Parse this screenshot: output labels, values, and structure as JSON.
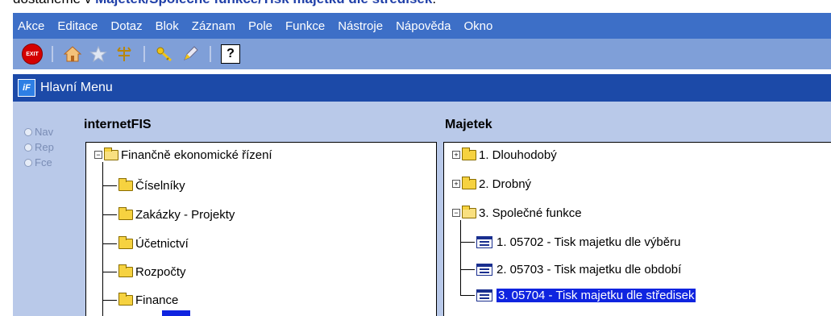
{
  "caption": {
    "prefix": "dostaneme v ",
    "path": "Majetek/Společné funkce/Tisk majetku dle středisek",
    "suffix": "."
  },
  "menubar": {
    "items": [
      {
        "label": "Akce"
      },
      {
        "label": "Editace"
      },
      {
        "label": "Dotaz"
      },
      {
        "label": "Blok"
      },
      {
        "label": "Záznam"
      },
      {
        "label": "Pole"
      },
      {
        "label": "Funkce"
      },
      {
        "label": "Nástroje"
      },
      {
        "label": "Nápověda"
      },
      {
        "label": "Okno"
      }
    ]
  },
  "toolbar": {
    "exit_label": "EXIT",
    "help_label": "?",
    "icons": [
      "exit-icon",
      "home-icon",
      "star-icon",
      "tree-icon",
      "key-icon",
      "pencil-icon",
      "help-icon"
    ]
  },
  "window": {
    "icon_label": "iF",
    "title": "Hlavní Menu"
  },
  "mode_radios": [
    {
      "label": "Nav"
    },
    {
      "label": "Rep"
    },
    {
      "label": "Fce"
    }
  ],
  "left_panel": {
    "title": "internetFIS",
    "root": {
      "label": "Finančně ekonomické řízení"
    },
    "children": [
      {
        "label": "Číselníky"
      },
      {
        "label": "Zakázky - Projekty"
      },
      {
        "label": "Účetnictví"
      },
      {
        "label": "Rozpočty"
      },
      {
        "label": "Finance"
      }
    ]
  },
  "right_panel": {
    "title": "Majetek",
    "nodes": [
      {
        "label": "1.  Dlouhodobý"
      },
      {
        "label": "2.  Drobný"
      },
      {
        "label": "3.  Společné funkce"
      }
    ],
    "forms": [
      {
        "label": "1.  05702 - Tisk majetku dle výběru"
      },
      {
        "label": "2.  05703 - Tisk majetku dle období"
      },
      {
        "label": "3.  05704 - Tisk  majetku dle středisek"
      }
    ]
  },
  "colors": {
    "menubar": "#3d6fc7",
    "toolbar": "#7f9fd8",
    "titlebar": "#1c4aa8",
    "client": "#b9c9e9",
    "selection": "#0f24e0"
  }
}
